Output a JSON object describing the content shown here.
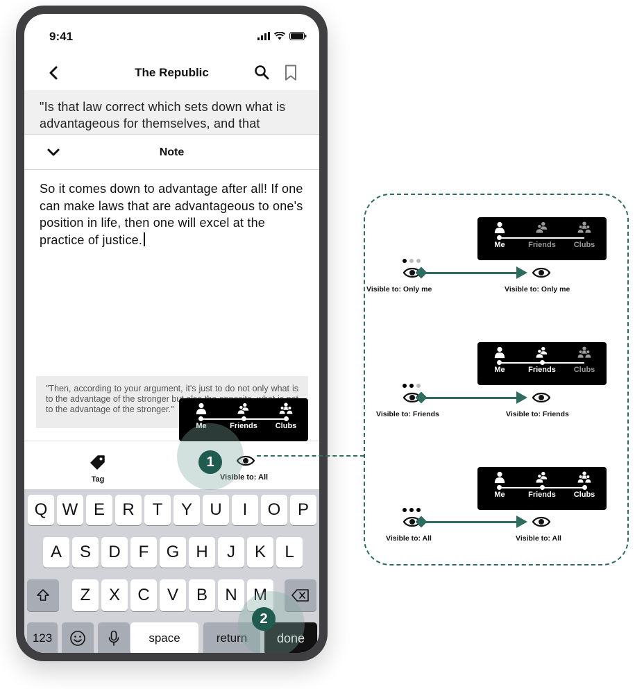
{
  "status": {
    "time": "9:41"
  },
  "nav": {
    "title": "The Republic"
  },
  "book_excerpt": "\"Is that law correct which sets down what is advantageous for themselves, and that",
  "note_sheet": {
    "title": "Note",
    "text": "So it comes down to advantage after all! If one can make laws that are advantageous to one's position in life, then one will excel at the practice of justice.",
    "quote": "\"Then, according to your argument, it's just to do not only what is to the advantage of the stronger but also the opposite, what is not to the advantage of the stronger.\""
  },
  "toolbar": {
    "tag_label": "Tag",
    "visibility_label": "Visible to: All"
  },
  "visibility_options": [
    "Me",
    "Friends",
    "Clubs"
  ],
  "keyboard": {
    "row1": [
      "Q",
      "W",
      "E",
      "R",
      "T",
      "Y",
      "U",
      "I",
      "O",
      "P"
    ],
    "row2": [
      "A",
      "S",
      "D",
      "F",
      "G",
      "H",
      "J",
      "K",
      "L"
    ],
    "row3": [
      "Z",
      "X",
      "C",
      "V",
      "B",
      "N",
      "M"
    ],
    "numbers": "123",
    "space": "space",
    "return": "return",
    "done": "done"
  },
  "badges": [
    "1",
    "2"
  ],
  "annotation": {
    "flows": [
      {
        "from_label": "Visible to: Only me",
        "to_label": "Visible to: Only me",
        "level": 1
      },
      {
        "from_label": "Visible to: Friends",
        "to_label": "Visible to: Friends",
        "level": 2
      },
      {
        "from_label": "Visible to: All",
        "to_label": "Visible to: All",
        "level": 3
      }
    ]
  },
  "colors": {
    "accent": "#2e6c60",
    "badge": "#1f5b4f",
    "popup_bg": "#000000"
  }
}
